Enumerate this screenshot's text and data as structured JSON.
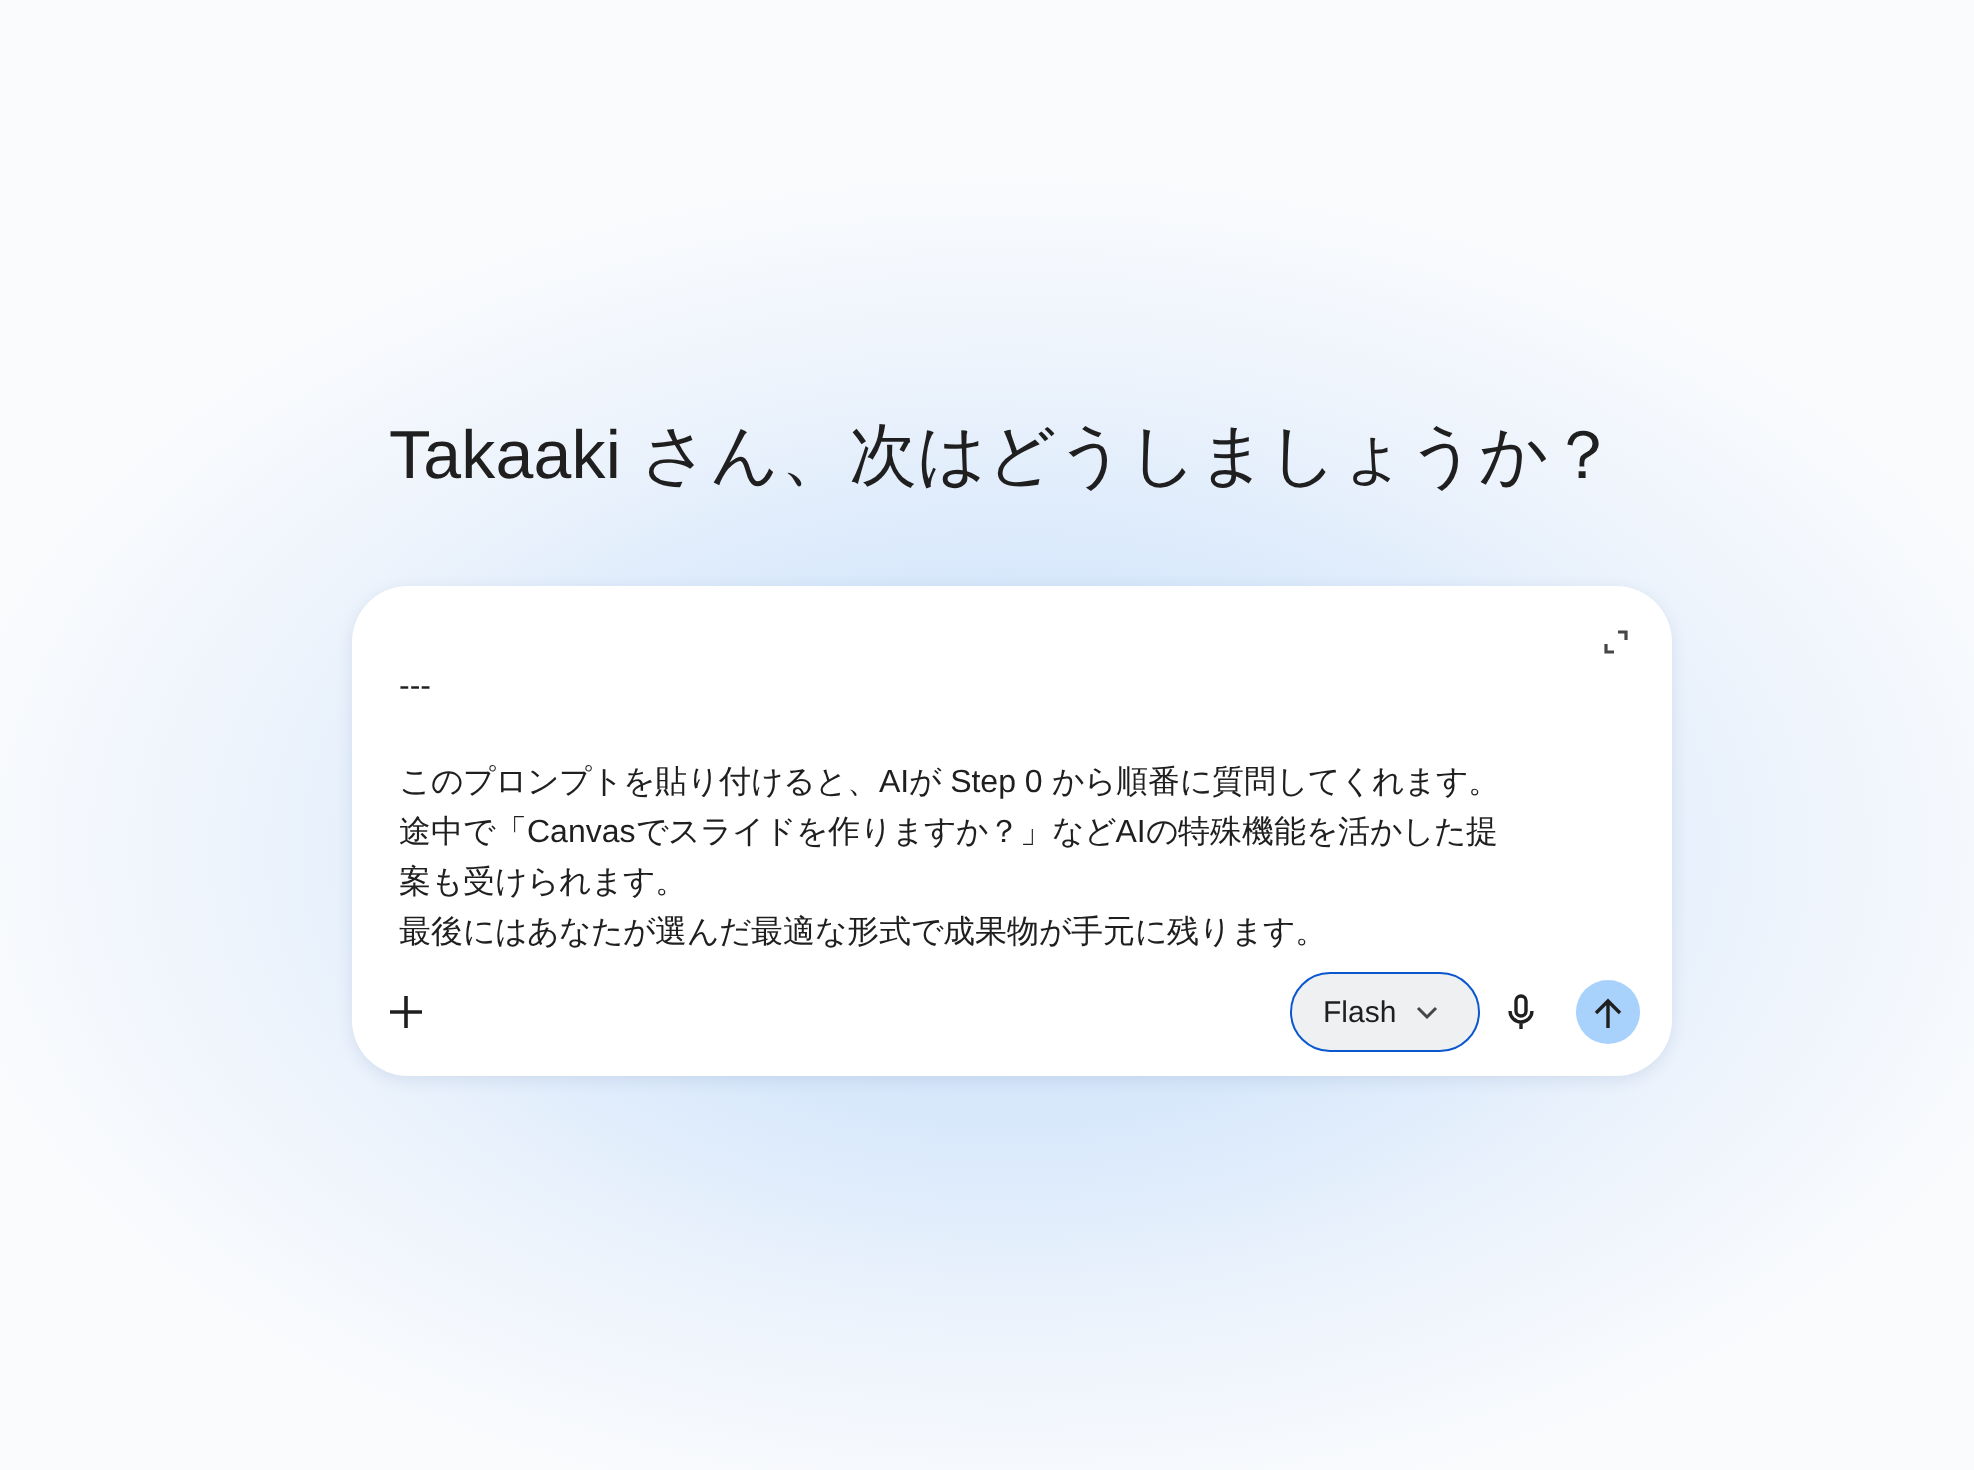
{
  "greeting": "Takaaki さん、次はどうしましょうか？",
  "prompt": {
    "paragraphs": [
      [
        "---"
      ],
      [
        "このプロンプトを貼り付けると、AIが Step 0 から順番に質問してくれます。",
        "途中で「Canvasでスライドを作りますか？」などAIの特殊機能を活かした提案も受けられます。",
        "最後にはあなたが選んだ最適な形式で成果物が手元に残ります。"
      ]
    ]
  },
  "model_picker": {
    "label": "Flash"
  }
}
